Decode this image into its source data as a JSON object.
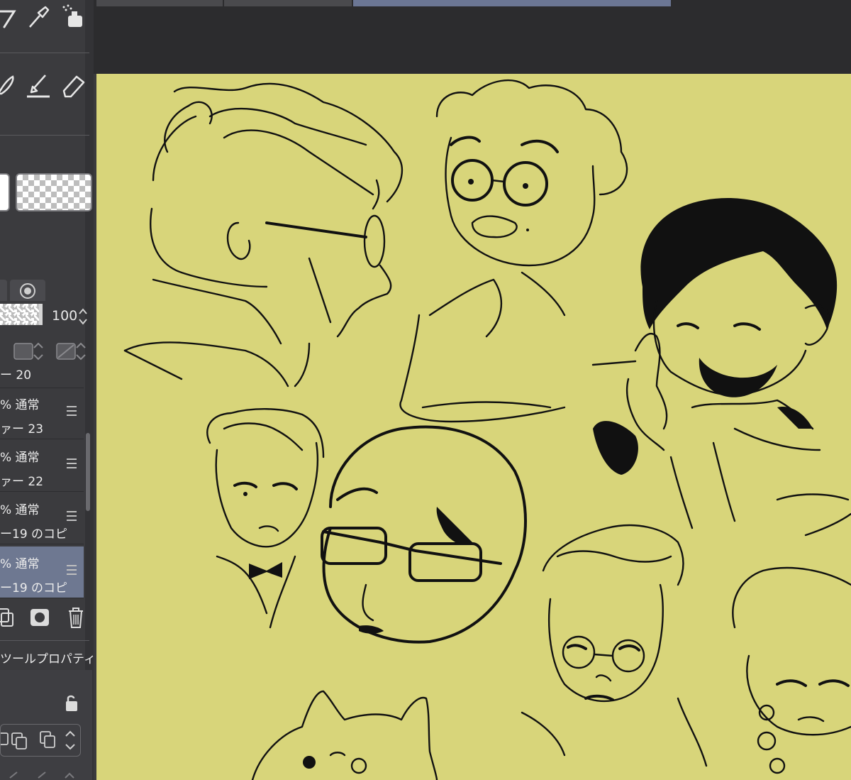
{
  "tabs": [
    "",
    "",
    "",
    ""
  ],
  "tools": {
    "row1": [
      "lasso-icon",
      "eyedropper-icon",
      "spray-icon"
    ],
    "row2": [
      "pen-icon",
      "fill-brush-icon",
      "eraser-icon"
    ]
  },
  "layer_panel": {
    "opacity_value": "100",
    "layers": [
      {
        "mode": "",
        "name": "ー 20",
        "selected": false
      },
      {
        "mode": "% 通常",
        "name": "ァー 23",
        "selected": false
      },
      {
        "mode": "% 通常",
        "name": "ァー 22",
        "selected": false
      },
      {
        "mode": "% 通常",
        "name": "ー19 のコピ",
        "selected": false
      },
      {
        "mode": "% 通常",
        "name": "ー19 のコピ",
        "selected": true
      }
    ]
  },
  "tool_property": {
    "title": "ツールプロパティ"
  },
  "colors": {
    "canvas_bg": "#d8d57a",
    "panel_bg": "#3b3b3e",
    "selection": "#6e7891",
    "topbar": "#2c2c2e"
  }
}
